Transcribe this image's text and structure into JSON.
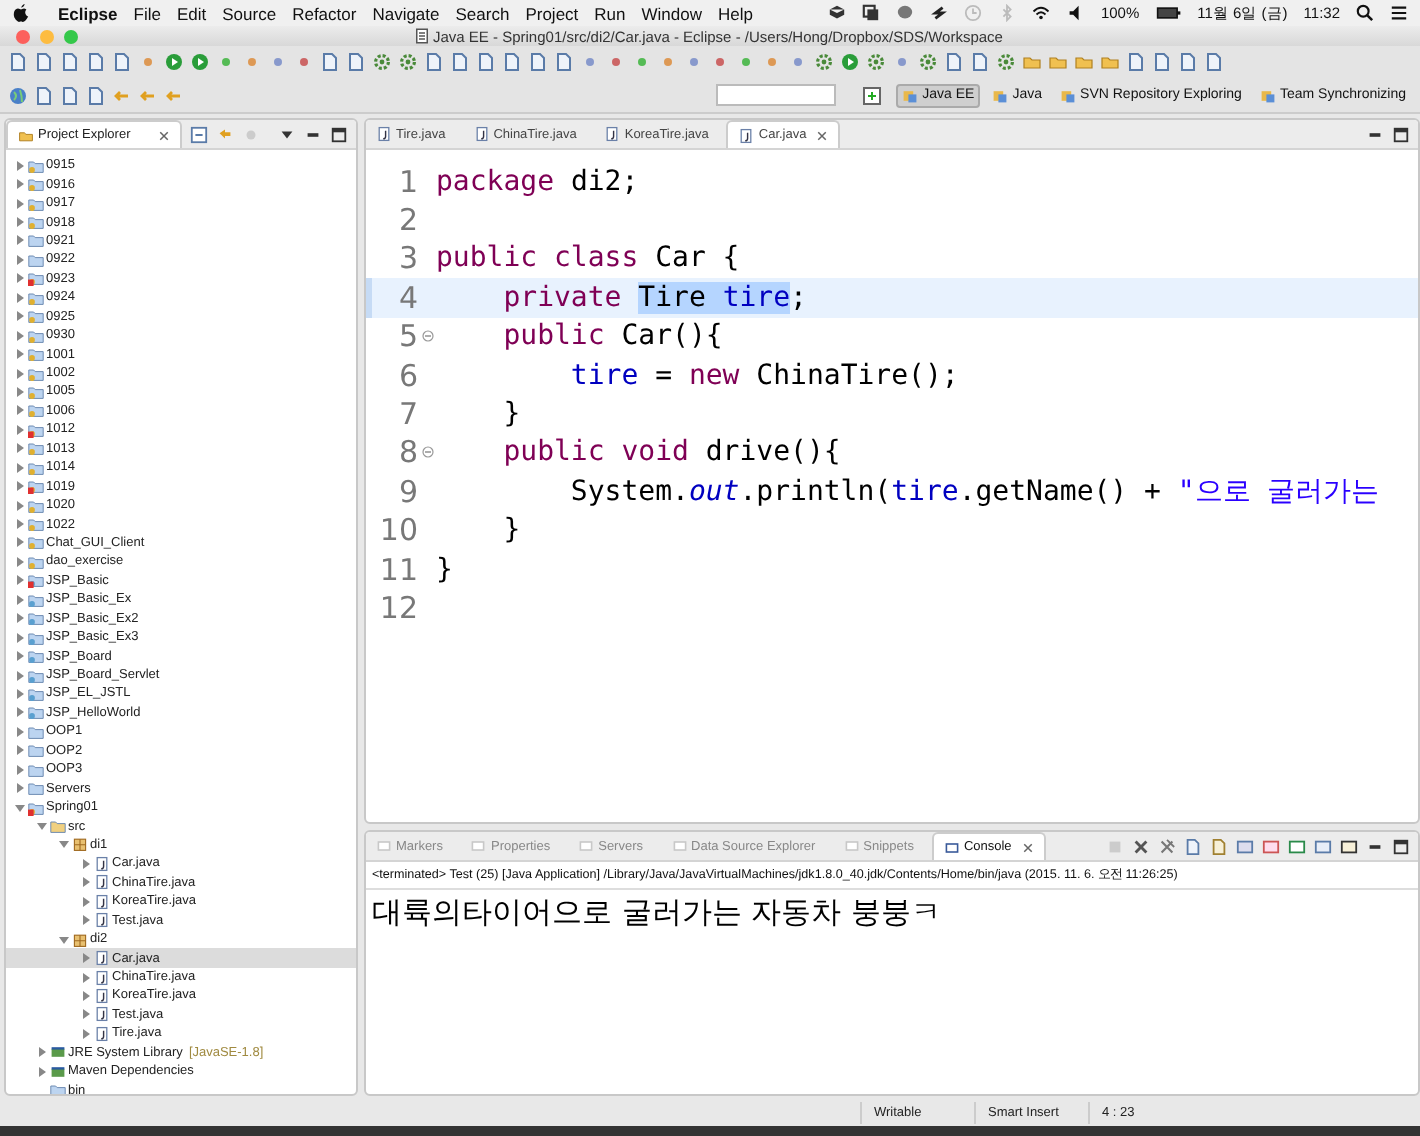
{
  "menubar": {
    "app": "Eclipse",
    "menus": [
      "File",
      "Edit",
      "Source",
      "Refactor",
      "Navigate",
      "Search",
      "Project",
      "Run",
      "Window",
      "Help"
    ],
    "battery": "100%",
    "date": "11월 6일 (금)",
    "time": "11:32"
  },
  "window": {
    "title": "Java EE - Spring01/src/di2/Car.java - Eclipse - /Users/Hong/Dropbox/SDS/Workspace"
  },
  "perspectives": [
    {
      "label": "Java EE",
      "selected": true
    },
    {
      "label": "Java",
      "selected": false
    },
    {
      "label": "SVN Repository Exploring",
      "selected": false
    },
    {
      "label": "Team Synchronizing",
      "selected": false
    }
  ],
  "explorer": {
    "title": "Project Explorer",
    "items": [
      {
        "label": "0915",
        "kind": "java-project",
        "expanded": false,
        "selected": false,
        "error": false
      },
      {
        "label": "0916",
        "kind": "java-project",
        "expanded": false,
        "selected": false,
        "error": false
      },
      {
        "label": "0917",
        "kind": "java-project",
        "expanded": false,
        "selected": false,
        "error": false
      },
      {
        "label": "0918",
        "kind": "java-project",
        "expanded": false,
        "selected": false,
        "error": false
      },
      {
        "label": "0921",
        "kind": "project",
        "expanded": false,
        "selected": false,
        "error": false
      },
      {
        "label": "0922",
        "kind": "project",
        "expanded": false,
        "selected": false,
        "error": false
      },
      {
        "label": "0923",
        "kind": "java-project",
        "expanded": false,
        "selected": false,
        "error": true
      },
      {
        "label": "0924",
        "kind": "java-project",
        "expanded": false,
        "selected": false,
        "error": false
      },
      {
        "label": "0925",
        "kind": "java-project",
        "expanded": false,
        "selected": false,
        "error": false
      },
      {
        "label": "0930",
        "kind": "java-project",
        "expanded": false,
        "selected": false,
        "error": false
      },
      {
        "label": "1001",
        "kind": "java-project",
        "expanded": false,
        "selected": false,
        "error": false
      },
      {
        "label": "1002",
        "kind": "java-project",
        "expanded": false,
        "selected": false,
        "error": false
      },
      {
        "label": "1005",
        "kind": "java-project",
        "expanded": false,
        "selected": false,
        "error": false
      },
      {
        "label": "1006",
        "kind": "java-project",
        "expanded": false,
        "selected": false,
        "error": false
      },
      {
        "label": "1012",
        "kind": "java-project",
        "expanded": false,
        "selected": false,
        "error": true
      },
      {
        "label": "1013",
        "kind": "java-project",
        "expanded": false,
        "selected": false,
        "error": false
      },
      {
        "label": "1014",
        "kind": "java-project",
        "expanded": false,
        "selected": false,
        "error": false
      },
      {
        "label": "1019",
        "kind": "java-project",
        "expanded": false,
        "selected": false,
        "error": true
      },
      {
        "label": "1020",
        "kind": "java-project",
        "expanded": false,
        "selected": false,
        "error": false
      },
      {
        "label": "1022",
        "kind": "java-project",
        "expanded": false,
        "selected": false,
        "error": false
      },
      {
        "label": "Chat_GUI_Client",
        "kind": "java-project",
        "expanded": false,
        "selected": false,
        "error": false
      },
      {
        "label": "dao_exercise",
        "kind": "java-project",
        "expanded": false,
        "selected": false,
        "error": false
      },
      {
        "label": "JSP_Basic",
        "kind": "web-project",
        "expanded": false,
        "selected": false,
        "error": true
      },
      {
        "label": "JSP_Basic_Ex",
        "kind": "web-project",
        "expanded": false,
        "selected": false,
        "error": false
      },
      {
        "label": "JSP_Basic_Ex2",
        "kind": "web-project",
        "expanded": false,
        "selected": false,
        "error": false
      },
      {
        "label": "JSP_Basic_Ex3",
        "kind": "web-project",
        "expanded": false,
        "selected": false,
        "error": false
      },
      {
        "label": "JSP_Board",
        "kind": "web-project",
        "expanded": false,
        "selected": false,
        "error": false
      },
      {
        "label": "JSP_Board_Servlet",
        "kind": "web-project",
        "expanded": false,
        "selected": false,
        "error": false
      },
      {
        "label": "JSP_EL_JSTL",
        "kind": "web-project",
        "expanded": false,
        "selected": false,
        "error": false
      },
      {
        "label": "JSP_HelloWorld",
        "kind": "web-project",
        "expanded": false,
        "selected": false,
        "error": false
      },
      {
        "label": "OOP1",
        "kind": "project",
        "expanded": false,
        "selected": false,
        "error": false
      },
      {
        "label": "OOP2",
        "kind": "project",
        "expanded": false,
        "selected": false,
        "error": false
      },
      {
        "label": "OOP3",
        "kind": "project",
        "expanded": false,
        "selected": false,
        "error": false
      },
      {
        "label": "Servers",
        "kind": "project",
        "expanded": false,
        "selected": false,
        "error": false
      },
      {
        "label": "Spring01",
        "kind": "java-project",
        "expanded": true,
        "selected": false,
        "error": true,
        "children": [
          {
            "label": "src",
            "kind": "source-folder",
            "expanded": true,
            "selected": false,
            "children": [
              {
                "label": "di1",
                "kind": "package",
                "expanded": true,
                "selected": false,
                "children": [
                  {
                    "label": "Car.java",
                    "kind": "java-file",
                    "expanded": false,
                    "selected": false
                  },
                  {
                    "label": "ChinaTire.java",
                    "kind": "java-file",
                    "expanded": false,
                    "selected": false
                  },
                  {
                    "label": "KoreaTire.java",
                    "kind": "java-file",
                    "expanded": false,
                    "selected": false
                  },
                  {
                    "label": "Test.java",
                    "kind": "java-file",
                    "expanded": false,
                    "selected": false
                  }
                ]
              },
              {
                "label": "di2",
                "kind": "package",
                "expanded": true,
                "selected": false,
                "children": [
                  {
                    "label": "Car.java",
                    "kind": "java-file",
                    "expanded": false,
                    "selected": true
                  },
                  {
                    "label": "ChinaTire.java",
                    "kind": "java-file",
                    "expanded": false,
                    "selected": false
                  },
                  {
                    "label": "KoreaTire.java",
                    "kind": "java-file",
                    "expanded": false,
                    "selected": false
                  },
                  {
                    "label": "Test.java",
                    "kind": "java-file",
                    "expanded": false,
                    "selected": false
                  },
                  {
                    "label": "Tire.java",
                    "kind": "java-file",
                    "expanded": false,
                    "selected": false
                  }
                ]
              }
            ]
          },
          {
            "label": "JRE System Library",
            "kind": "library",
            "decoration": "[JavaSE-1.8]",
            "expanded": false,
            "selected": false
          },
          {
            "label": "Maven Dependencies",
            "kind": "library",
            "expanded": false,
            "selected": false
          },
          {
            "label": "bin",
            "kind": "folder",
            "selected": false
          }
        ]
      }
    ]
  },
  "editor": {
    "tabs": [
      {
        "label": "Tire.java",
        "selected": false
      },
      {
        "label": "ChinaTire.java",
        "selected": false
      },
      {
        "label": "KoreaTire.java",
        "selected": false
      },
      {
        "label": "Car.java",
        "selected": true
      }
    ],
    "lines": [
      {
        "number": "1",
        "current": false,
        "foldable": false,
        "tokens": [
          {
            "text": "package",
            "kind": "keyword"
          },
          {
            "text": " di2;",
            "kind": "plain"
          }
        ]
      },
      {
        "number": "2",
        "current": false,
        "foldable": false
      },
      {
        "number": "3",
        "current": false,
        "foldable": false,
        "tokens": [
          {
            "text": "public class",
            "kind": "keyword"
          },
          {
            "text": " Car {",
            "kind": "plain"
          }
        ]
      },
      {
        "number": "4",
        "current": true,
        "foldable": false,
        "tokens": [
          {
            "text": "    private ",
            "kind": "keyword",
            "selected": false
          },
          {
            "text": "Tire ",
            "kind": "plain",
            "selected": true
          },
          {
            "text": "tire",
            "kind": "field",
            "selected": true
          },
          {
            "text": ";",
            "kind": "plain",
            "selected": false
          }
        ]
      },
      {
        "number": "5",
        "current": false,
        "foldable": true,
        "tokens": [
          {
            "text": "    public",
            "kind": "keyword"
          },
          {
            "text": " Car(){",
            "kind": "plain"
          }
        ]
      },
      {
        "number": "6",
        "current": false,
        "foldable": false,
        "tokens": [
          {
            "text": "        tire",
            "kind": "field"
          },
          {
            "text": " = ",
            "kind": "plain"
          },
          {
            "text": "new",
            "kind": "keyword"
          },
          {
            "text": " ChinaTire();",
            "kind": "plain"
          }
        ]
      },
      {
        "number": "7",
        "current": false,
        "foldable": false,
        "tokens": [
          {
            "text": "    }",
            "kind": "plain"
          }
        ]
      },
      {
        "number": "8",
        "current": false,
        "foldable": true,
        "tokens": [
          {
            "text": "    public void",
            "kind": "keyword"
          },
          {
            "text": " drive(){",
            "kind": "plain"
          }
        ]
      },
      {
        "number": "9",
        "current": false,
        "foldable": false,
        "tokens": [
          {
            "text": "        System.",
            "kind": "plain"
          },
          {
            "text": "out",
            "kind": "static-field"
          },
          {
            "text": ".println(",
            "kind": "plain"
          },
          {
            "text": "tire",
            "kind": "field"
          },
          {
            "text": ".getName() + ",
            "kind": "plain"
          },
          {
            "text": "\"으로 굴러가는",
            "kind": "string"
          }
        ]
      },
      {
        "number": "10",
        "current": false,
        "foldable": false,
        "tokens": [
          {
            "text": "    }",
            "kind": "plain"
          }
        ]
      },
      {
        "number": "11",
        "current": false,
        "foldable": false,
        "tokens": [
          {
            "text": "}",
            "kind": "plain"
          }
        ]
      },
      {
        "number": "12",
        "current": false,
        "foldable": false
      }
    ]
  },
  "console": {
    "tabs": [
      {
        "label": "Markers",
        "selected": false
      },
      {
        "label": "Properties",
        "selected": false
      },
      {
        "label": "Servers",
        "selected": false
      },
      {
        "label": "Data Source Explorer",
        "selected": false
      },
      {
        "label": "Snippets",
        "selected": false
      },
      {
        "label": "Console",
        "selected": true
      }
    ],
    "header": "<terminated> Test (25) [Java Application] /Library/Java/JavaVirtualMachines/jdk1.8.0_40.jdk/Contents/Home/bin/java (2015. 11. 6. 오전 11:26:25)",
    "output": "대륙의타이어으로 굴러가는 자동차 붕붕ㅋ"
  },
  "status_bar": [
    "Writable",
    "Smart Insert",
    "4 : 23"
  ]
}
